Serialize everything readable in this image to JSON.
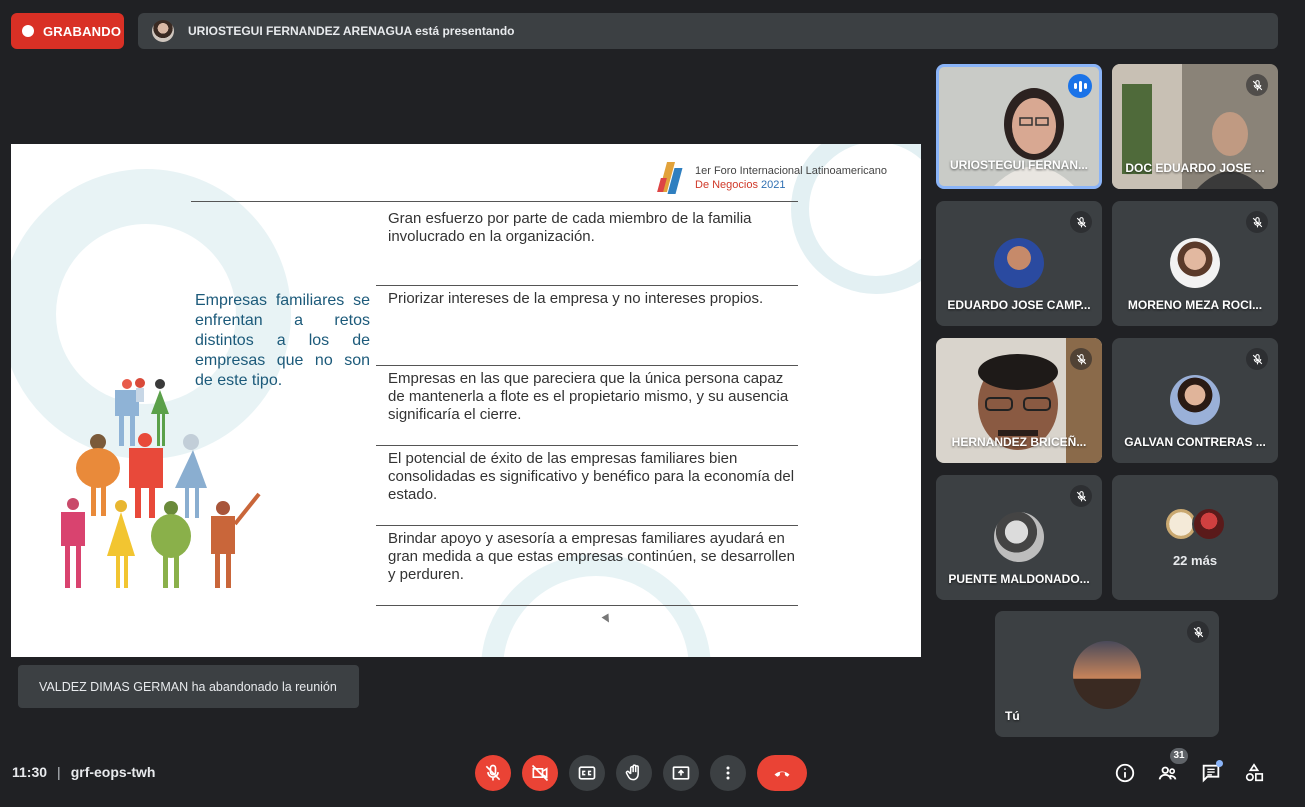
{
  "recording": {
    "label": "GRABANDO"
  },
  "presenting": {
    "text": "URIOSTEGUI FERNANDEZ ARENAGUA está presentando"
  },
  "slide": {
    "logo_line1": "1er Foro Internacional Latinoamericano",
    "logo_line2_a": "De Negocios",
    "logo_line2_b": "2021",
    "left_statement": "Empresas familiares se enfrentan a retos distintos a los de empresas que no son de este tipo.",
    "rows": [
      "Gran esfuerzo por parte de cada miembro de la familia involucrado en la organización.",
      "Priorizar intereses de la empresa y no intereses propios.",
      "Empresas en las que pareciera que la única persona capaz de mantenerla a flote es el propietario mismo, y su ausencia significaría el cierre.",
      "El potencial de éxito de las empresas familiares bien consolidadas es significativo y benéfico para la economía del estado.",
      "Brindar apoyo y asesoría a empresas familiares ayudará en gran medida a que estas empresas continúen, se desarrollen y perduren."
    ]
  },
  "participants": [
    {
      "name": "URIOSTEGUI FERNAN...",
      "speaking": true
    },
    {
      "name": "DOC EDUARDO JOSE ...",
      "muted": true
    },
    {
      "name": "EDUARDO JOSE CAMP...",
      "muted": true
    },
    {
      "name": "MORENO MEZA ROCI...",
      "muted": true
    },
    {
      "name": "HERNANDEZ BRICEÑ...",
      "muted": true
    },
    {
      "name": "GALVAN CONTRERAS ...",
      "muted": true
    },
    {
      "name": "PUENTE MALDONADO...",
      "muted": true
    }
  ],
  "more": {
    "label": "22 más"
  },
  "self": {
    "name": "Tú"
  },
  "toast": {
    "text": "VALDEZ DIMAS GERMAN ha abandonado la reunión"
  },
  "meeting": {
    "time": "11:30",
    "separator": "|",
    "code": "grf-eops-twh"
  },
  "people_count": "31",
  "colors": {
    "record_red": "#d93025",
    "control_red": "#ea4335",
    "speaking_blue": "#1a73e8",
    "surface": "#3c4043",
    "background": "#202124"
  },
  "icons": {
    "mic": "mic-off-icon",
    "camera": "videocam-off-icon",
    "captions": "closed-caption-icon",
    "hand": "raise-hand-icon",
    "present": "present-screen-icon",
    "more": "more-vert-icon",
    "leave": "call-end-icon",
    "info": "info-icon",
    "people": "people-icon",
    "chat": "chat-icon",
    "activities": "activities-icon"
  }
}
